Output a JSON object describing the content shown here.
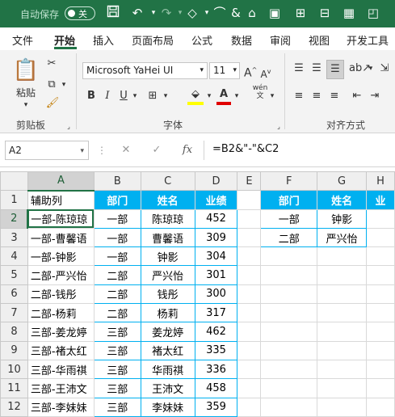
{
  "titlebar": {
    "autosave_label": "自动保存",
    "toggle_state": "关"
  },
  "ribbon_tabs": [
    "文件",
    "开始",
    "插入",
    "页面布局",
    "公式",
    "数据",
    "审阅",
    "视图",
    "开发工具"
  ],
  "ribbon": {
    "paste_label": "粘贴",
    "clipboard_label": "剪贴板",
    "font_group_label": "字体",
    "align_group_label": "对齐方式",
    "font_name": "Microsoft YaHei UI",
    "font_size": "11",
    "bold": "B",
    "italic": "I",
    "underline": "U",
    "wen": "wén"
  },
  "formula_bar": {
    "name_box": "A2",
    "fx": "fx",
    "formula": "=B2&\"-\"&C2"
  },
  "sheet": {
    "columns": [
      "A",
      "B",
      "C",
      "D",
      "E",
      "F",
      "G",
      "H"
    ],
    "rows": [
      {
        "n": "1",
        "A": "辅助列",
        "B": "部门",
        "C": "姓名",
        "D": "业绩",
        "F": "部门",
        "G": "姓名",
        "H": "业"
      },
      {
        "n": "2",
        "A": "一部-陈琼琼",
        "B": "一部",
        "C": "陈琼琼",
        "D": "452",
        "F": "一部",
        "G": "钟影",
        "H": ""
      },
      {
        "n": "3",
        "A": "一部-曹馨语",
        "B": "一部",
        "C": "曹馨语",
        "D": "309",
        "F": "二部",
        "G": "严兴怡",
        "H": ""
      },
      {
        "n": "4",
        "A": "一部-钟影",
        "B": "一部",
        "C": "钟影",
        "D": "304",
        "F": "",
        "G": "",
        "H": ""
      },
      {
        "n": "5",
        "A": "二部-严兴怡",
        "B": "二部",
        "C": "严兴怡",
        "D": "301",
        "F": "",
        "G": "",
        "H": ""
      },
      {
        "n": "6",
        "A": "二部-钱彤",
        "B": "二部",
        "C": "钱彤",
        "D": "300",
        "F": "",
        "G": "",
        "H": ""
      },
      {
        "n": "7",
        "A": "二部-杨莉",
        "B": "二部",
        "C": "杨莉",
        "D": "317",
        "F": "",
        "G": "",
        "H": ""
      },
      {
        "n": "8",
        "A": "三部-姜龙婷",
        "B": "三部",
        "C": "姜龙婷",
        "D": "462",
        "F": "",
        "G": "",
        "H": ""
      },
      {
        "n": "9",
        "A": "三部-褚太红",
        "B": "三部",
        "C": "褚太红",
        "D": "335",
        "F": "",
        "G": "",
        "H": ""
      },
      {
        "n": "10",
        "A": "三部-华雨祺",
        "B": "三部",
        "C": "华雨祺",
        "D": "336",
        "F": "",
        "G": "",
        "H": ""
      },
      {
        "n": "11",
        "A": "三部-王沛文",
        "B": "三部",
        "C": "王沛文",
        "D": "458",
        "F": "",
        "G": "",
        "H": ""
      },
      {
        "n": "12",
        "A": "三部-李妹妹",
        "B": "三部",
        "C": "李妹妹",
        "D": "359",
        "F": "",
        "G": "",
        "H": ""
      }
    ]
  }
}
